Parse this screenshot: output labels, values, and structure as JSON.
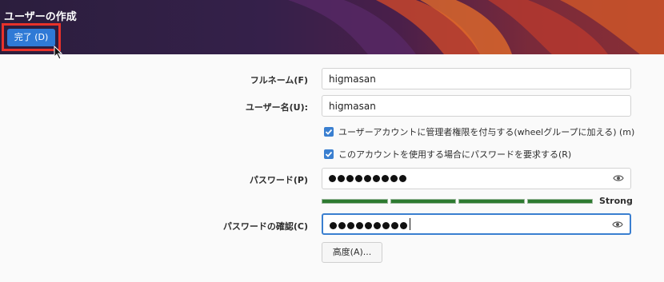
{
  "header": {
    "title": "ユーザーの作成",
    "done_label": "完了 (D)"
  },
  "form": {
    "fullname": {
      "label": "フルネーム(F)",
      "value": "higmasan"
    },
    "username": {
      "label": "ユーザー名(U):",
      "value": "higmasan"
    },
    "admin_checkbox": {
      "label": "ユーザーアカウントに管理者権限を付与する(wheelグループに加える) (m)",
      "checked": true
    },
    "require_password_checkbox": {
      "label": "このアカウントを使用する場合にパスワードを要求する(R)",
      "checked": true
    },
    "password": {
      "label": "パスワード(P)",
      "masked_length": 9
    },
    "strength": {
      "text": "Strong",
      "level": 1.0,
      "color": "#2d7a30"
    },
    "confirm": {
      "label": "パスワードの確認(C)",
      "masked_length": 9
    },
    "advanced_label": "高度(A)..."
  },
  "colors": {
    "accent": "#3a7fd0",
    "done_button": "#2f7ad6",
    "highlight": "#e8322a"
  },
  "icons": {
    "show_password": "eye-icon",
    "pointer": "mouse-cursor-icon"
  }
}
